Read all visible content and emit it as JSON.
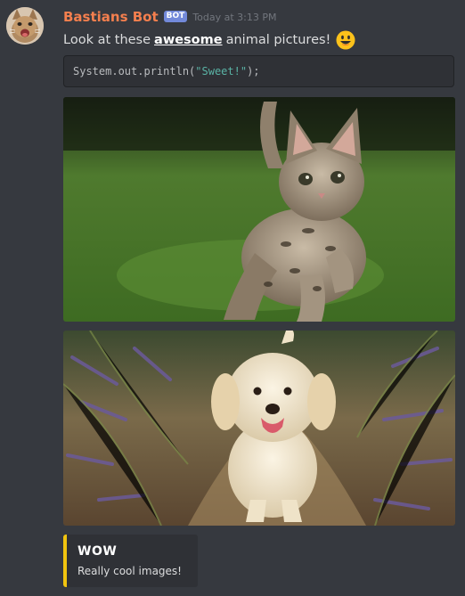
{
  "message": {
    "author": "Bastians Bot",
    "bot_tag": "BOT",
    "timestamp": "Today at 3:13 PM",
    "text_before": "Look at these",
    "text_strong": "awesome",
    "text_after": "animal pictures!",
    "emoji": "smiley-emoji",
    "code": {
      "prefix": "System.out.println(",
      "string": "\"Sweet!\"",
      "suffix": ");"
    }
  },
  "attachments": [
    {
      "subject": "kitten-photo"
    },
    {
      "subject": "puppy-photo"
    }
  ],
  "embed": {
    "title": "WOW",
    "description": "Really cool images!",
    "accent_color": "#f1c40f"
  },
  "colors": {
    "background": "#36393f",
    "username": "#f47f4e",
    "bot_tag": "#7289da",
    "code_string": "#5ab3a5"
  }
}
